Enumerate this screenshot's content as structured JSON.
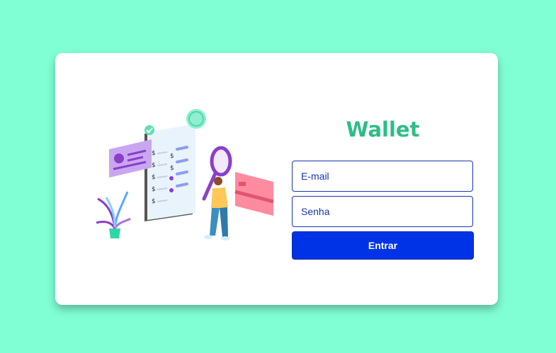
{
  "login": {
    "title": "Wallet",
    "email_placeholder": "E-mail",
    "password_placeholder": "Senha",
    "submit_label": "Entrar"
  },
  "colors": {
    "background": "#80ffd4",
    "title": "#2ebd86",
    "button": "#0033e6",
    "input_border": "#1a35b3"
  },
  "icons": [
    "finance-illustration"
  ]
}
